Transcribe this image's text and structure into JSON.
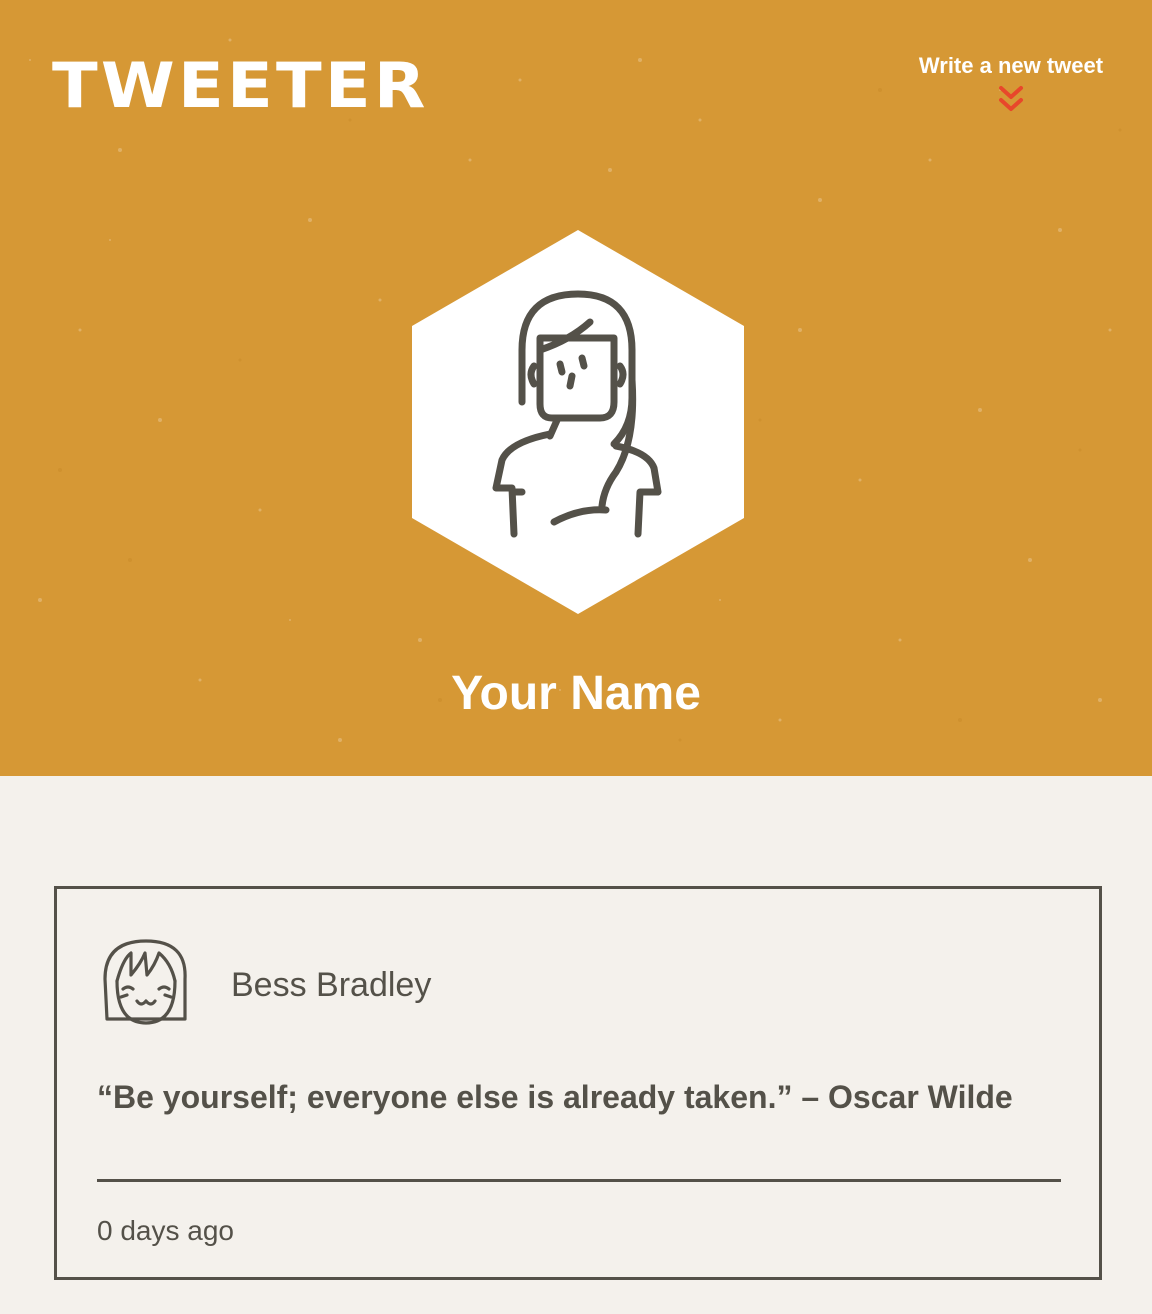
{
  "header": {
    "logo_text": "TWEETER",
    "new_tweet_label": "Write a new tweet",
    "new_tweet_icon": "chevron-double-down-icon",
    "background_color": "#d69835",
    "accent_color": "#e8472b"
  },
  "profile": {
    "name": "Your Name",
    "avatar_icon": "woman-avatar-icon"
  },
  "tweets": [
    {
      "author": "Bess Bradley",
      "avatar_icon": "smiling-girl-avatar-icon",
      "content": "“Be yourself; everyone else is already taken.” – Oscar Wilde",
      "timestamp": "0 days ago"
    }
  ],
  "colors": {
    "page_background": "#f4f1ec",
    "text_dark": "#545149"
  }
}
